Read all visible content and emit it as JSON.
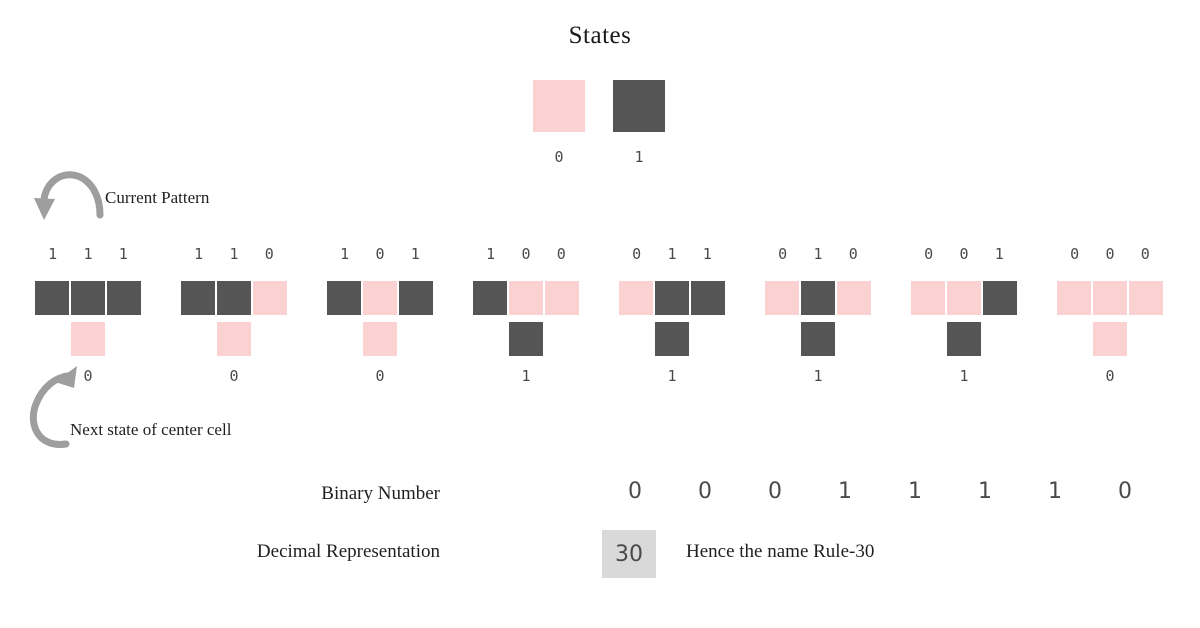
{
  "title": "States",
  "colors": {
    "state_zero": "#fcd1d1",
    "state_one": "#555555",
    "decimal_box_bg": "#d9d9d9",
    "arrow": "#9e9e9e",
    "text": "#1f1f1f",
    "mono_text": "#4a4a4a"
  },
  "states_legend": [
    {
      "label": "0",
      "color": "#fcd1d1"
    },
    {
      "label": "1",
      "color": "#555555"
    }
  ],
  "annotations": {
    "current_pattern": "Current Pattern",
    "next_state": "Next state of center cell"
  },
  "icons": {
    "arrow_current_pattern": "curved-arrow-down-left-icon",
    "arrow_next_state": "curved-arrow-up-right-icon"
  },
  "rules": [
    {
      "pattern": [
        "1",
        "1",
        "1"
      ],
      "result": "0"
    },
    {
      "pattern": [
        "1",
        "1",
        "0"
      ],
      "result": "0"
    },
    {
      "pattern": [
        "1",
        "0",
        "1"
      ],
      "result": "0"
    },
    {
      "pattern": [
        "1",
        "0",
        "0"
      ],
      "result": "1"
    },
    {
      "pattern": [
        "0",
        "1",
        "1"
      ],
      "result": "1"
    },
    {
      "pattern": [
        "0",
        "1",
        "0"
      ],
      "result": "1"
    },
    {
      "pattern": [
        "0",
        "0",
        "1"
      ],
      "result": "1"
    },
    {
      "pattern": [
        "0",
        "0",
        "0"
      ],
      "result": "0"
    }
  ],
  "binary": {
    "label": "Binary Number",
    "digits": [
      "0",
      "0",
      "0",
      "1",
      "1",
      "1",
      "1",
      "0"
    ]
  },
  "decimal": {
    "label": "Decimal Representation",
    "value": "30",
    "note": "Hence the name Rule-30"
  }
}
